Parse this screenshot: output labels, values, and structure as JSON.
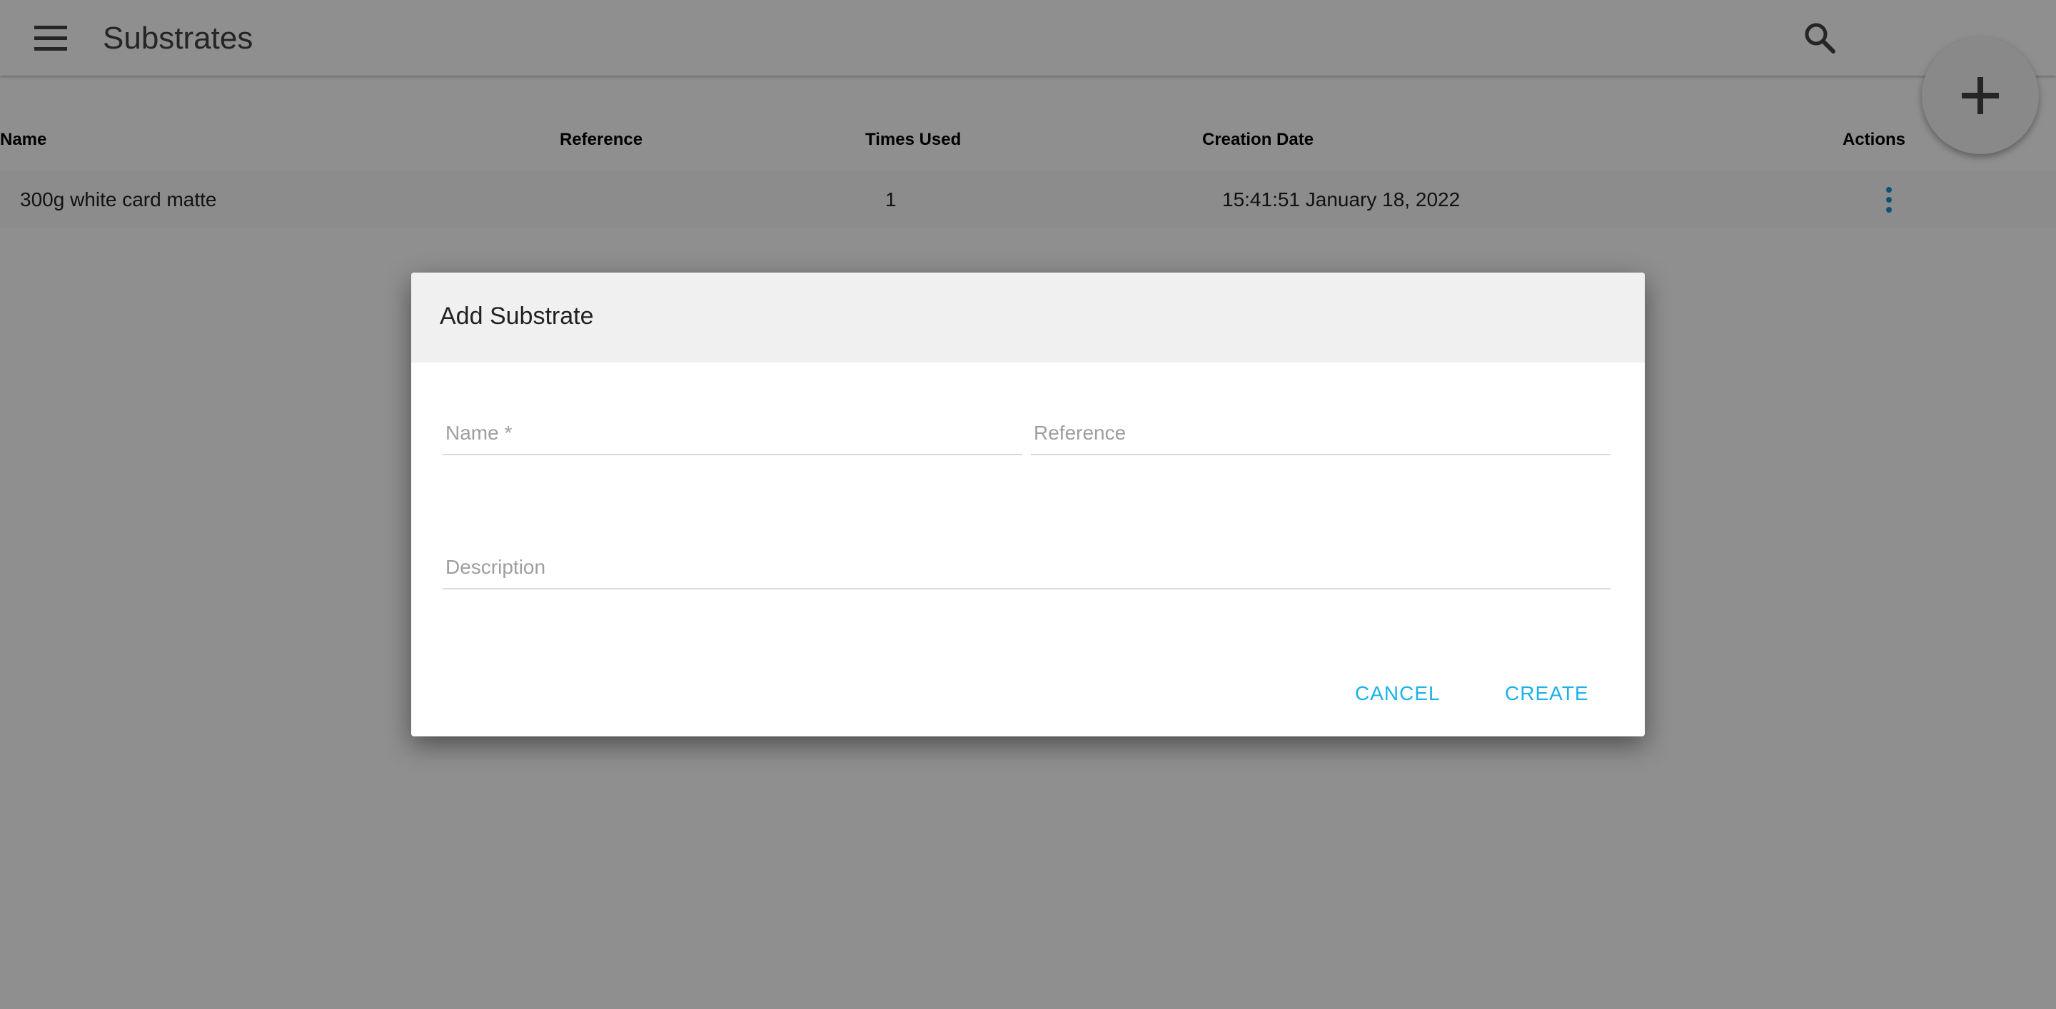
{
  "appbar": {
    "title": "Substrates",
    "menu_icon": "menu-icon",
    "search_icon": "search-icon",
    "add_icon": "plus-icon"
  },
  "table": {
    "columns": [
      "Name",
      "Reference",
      "Times Used",
      "Creation Date",
      "Actions"
    ],
    "rows": [
      {
        "name": "300g white card matte",
        "reference": "",
        "times_used": "1",
        "creation_date": "15:41:51 January 18, 2022",
        "actions_icon": "more-vert-icon"
      }
    ]
  },
  "dialog": {
    "title": "Add Substrate",
    "fields": {
      "name": {
        "value": "",
        "placeholder": "Name *"
      },
      "reference": {
        "value": "",
        "placeholder": "Reference"
      },
      "description": {
        "value": "",
        "placeholder": "Description"
      }
    },
    "cancel_label": "CANCEL",
    "create_label": "CREATE"
  },
  "colors": {
    "accent": "#1ab2e8",
    "overlay": "rgba(0,0,0,0.44)"
  }
}
